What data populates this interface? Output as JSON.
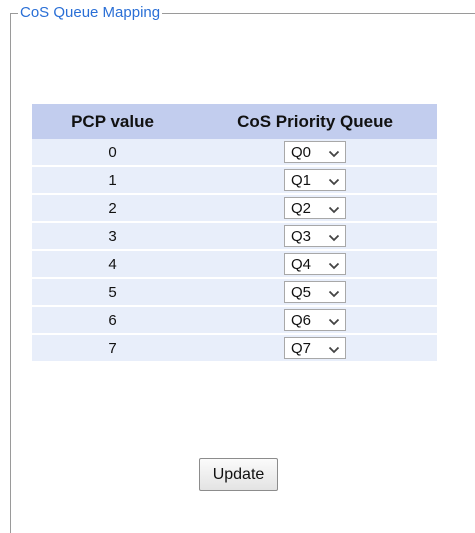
{
  "panel": {
    "legend": "CoS Queue Mapping"
  },
  "table": {
    "headers": [
      "PCP value",
      "CoS Priority Queue"
    ],
    "rows": [
      {
        "pcp": "0",
        "queue": "Q0"
      },
      {
        "pcp": "1",
        "queue": "Q1"
      },
      {
        "pcp": "2",
        "queue": "Q2"
      },
      {
        "pcp": "3",
        "queue": "Q3"
      },
      {
        "pcp": "4",
        "queue": "Q4"
      },
      {
        "pcp": "5",
        "queue": "Q5"
      },
      {
        "pcp": "6",
        "queue": "Q6"
      },
      {
        "pcp": "7",
        "queue": "Q7"
      }
    ]
  },
  "actions": {
    "update_label": "Update"
  },
  "colors": {
    "legend_text": "#2a6fd6",
    "header_bg": "#c2cdee",
    "row_bg": "#e8eefa"
  },
  "icons": {
    "select_arrow": "chevron-down-icon"
  }
}
